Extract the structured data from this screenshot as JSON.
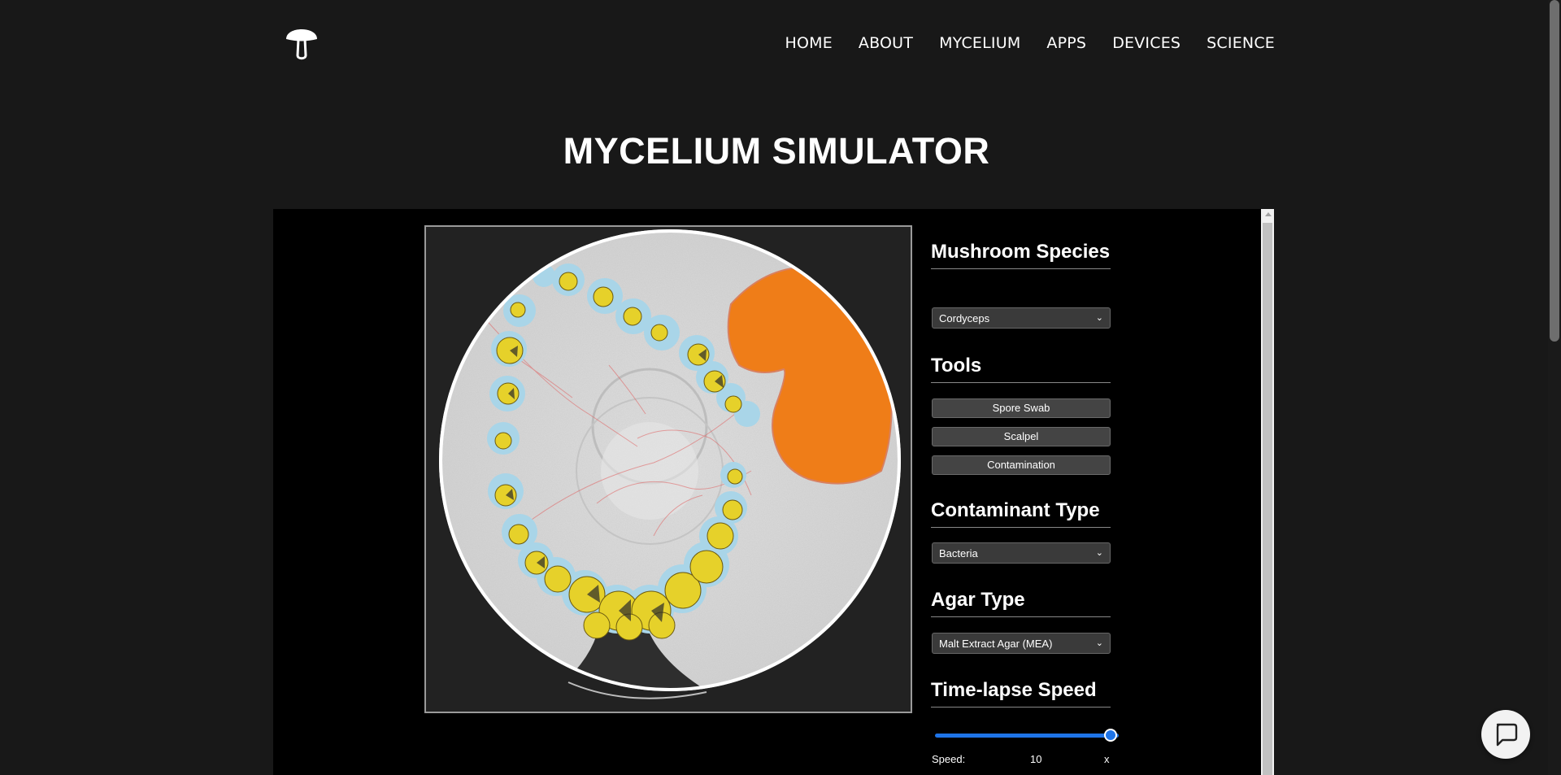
{
  "nav": {
    "logo": "mushroom-logo-icon",
    "items": [
      "HOME",
      "ABOUT",
      "MYCELIUM",
      "APPS",
      "DEVICES",
      "SCIENCE"
    ]
  },
  "page_title": "MYCELIUM SIMULATOR",
  "controls": {
    "species": {
      "heading": "Mushroom Species",
      "selected": "Cordyceps"
    },
    "tools": {
      "heading": "Tools",
      "buttons": [
        "Spore Swab",
        "Scalpel",
        "Contamination"
      ]
    },
    "contaminant": {
      "heading": "Contaminant Type",
      "selected": "Bacteria"
    },
    "agar": {
      "heading": "Agar Type",
      "selected": "Malt Extract Agar (MEA)"
    },
    "timelapse": {
      "heading": "Time-lapse Speed",
      "speed_label": "Speed:",
      "speed_value": "10",
      "speed_unit": "x",
      "slider_fraction": 1.0
    }
  },
  "chat": {
    "icon": "chat-bubble-icon"
  },
  "colors": {
    "background": "#181818",
    "accent": "#1e74e8",
    "contamination": "#f0801a",
    "colony": "#e8d830",
    "halo": "#a8d4e6"
  }
}
